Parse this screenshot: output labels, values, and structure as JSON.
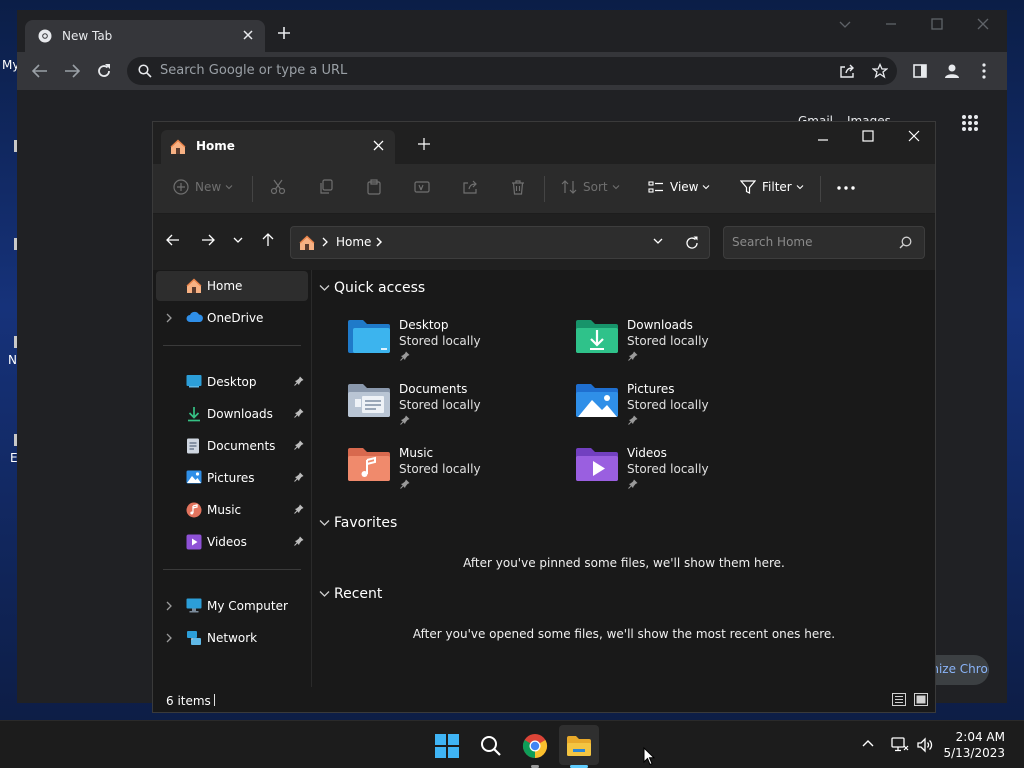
{
  "desktop": {
    "fragments": [
      "My",
      "N",
      "E"
    ]
  },
  "chrome": {
    "tab_title": "New Tab",
    "omnibox_placeholder": "Search Google or type a URL",
    "ntp_links": [
      "Gmail",
      "Images"
    ],
    "customize_label": "Customize Chrome"
  },
  "explorer": {
    "tab_title": "Home",
    "commands": {
      "new": "New",
      "sort": "Sort",
      "view": "View",
      "filter": "Filter"
    },
    "address": {
      "crumb": "Home",
      "search_placeholder": "Search Home"
    },
    "nav": {
      "home": "Home",
      "onedrive": "OneDrive",
      "pinned": [
        "Desktop",
        "Downloads",
        "Documents",
        "Pictures",
        "Music",
        "Videos"
      ],
      "my_computer": "My Computer",
      "network": "Network"
    },
    "sections": {
      "quick_access": "Quick access",
      "favorites": "Favorites",
      "recent": "Recent"
    },
    "quick_access_items": [
      {
        "name": "Desktop",
        "status": "Stored locally"
      },
      {
        "name": "Downloads",
        "status": "Stored locally"
      },
      {
        "name": "Documents",
        "status": "Stored locally"
      },
      {
        "name": "Pictures",
        "status": "Stored locally"
      },
      {
        "name": "Music",
        "status": "Stored locally"
      },
      {
        "name": "Videos",
        "status": "Stored locally"
      }
    ],
    "favorites_empty": "After you've pinned some files, we'll show them here.",
    "recent_empty": "After you've opened some files, we'll show the most recent ones here.",
    "status_count": "6 items"
  },
  "taskbar": {
    "time": "2:04 AM",
    "date": "5/13/2023"
  },
  "colors": {
    "accent": "#60cdff",
    "folder_yellow": "#f4c542"
  }
}
